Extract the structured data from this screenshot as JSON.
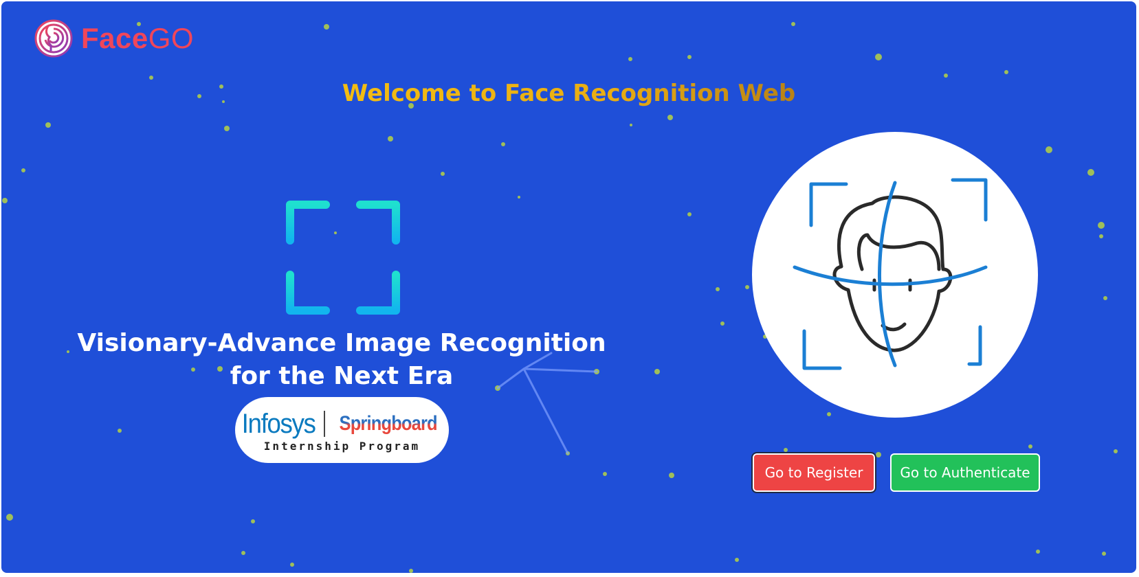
{
  "brand": {
    "name_bold": "Face",
    "name_light": "GO",
    "logo_icon": "face-maze-icon",
    "color": "#f0465a"
  },
  "header": {
    "welcome": "Welcome to Face Recognition Web"
  },
  "hero": {
    "headline_line1": "Visionary-Advance Image Recognition",
    "headline_line2": "for the Next Era",
    "scan_icon": "scan-frame-icon"
  },
  "partner": {
    "brand_left": "Infosys",
    "brand_right": "Springboard",
    "subtitle": "Internship Program"
  },
  "illustration": {
    "icon": "face-recognition-icon"
  },
  "actions": {
    "register_label": "Go to Register",
    "authenticate_label": "Go to Authenticate"
  },
  "colors": {
    "background": "#1f4fd8",
    "welcome_text": "#f0b21a",
    "register": "#ee4444",
    "authenticate": "#22c15a",
    "dots": "#9fbf5a",
    "scan_icon": "#1ec7e6",
    "face_lines": "#1b7fd4"
  }
}
